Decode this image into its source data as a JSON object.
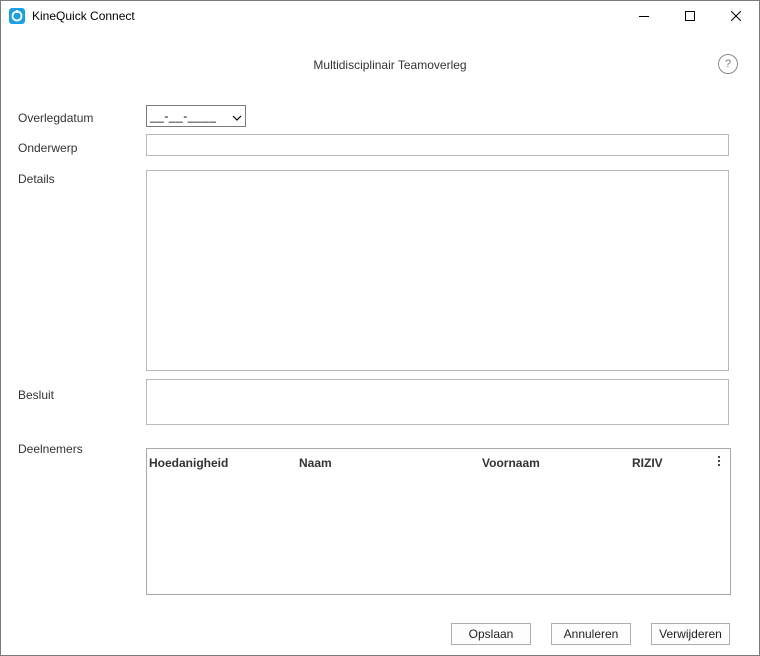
{
  "window": {
    "title": "KineQuick Connect",
    "icon": "kinequick-app-icon",
    "controls": [
      "minimize-icon",
      "maximize-icon",
      "close-icon"
    ]
  },
  "dialog": {
    "title": "Multidisciplinair Teamoverleg",
    "help_label": "?"
  },
  "form": {
    "date_label": "Overlegdatum",
    "date_value": "__-__-____",
    "subject_label": "Onderwerp",
    "subject_value": "",
    "details_label": "Details",
    "details_value": "",
    "decision_label": "Besluit",
    "decision_value": "",
    "participants_label": "Deelnemers"
  },
  "participants_table": {
    "columns": [
      "Hoedanigheid",
      "Naam",
      "Voornaam",
      "RIZIV"
    ],
    "rows": []
  },
  "buttons": {
    "save": "Opslaan",
    "cancel": "Annuleren",
    "delete": "Verwijderen"
  },
  "colors": {
    "accent": "#1ba1e2",
    "border": "#b9b9b9"
  }
}
